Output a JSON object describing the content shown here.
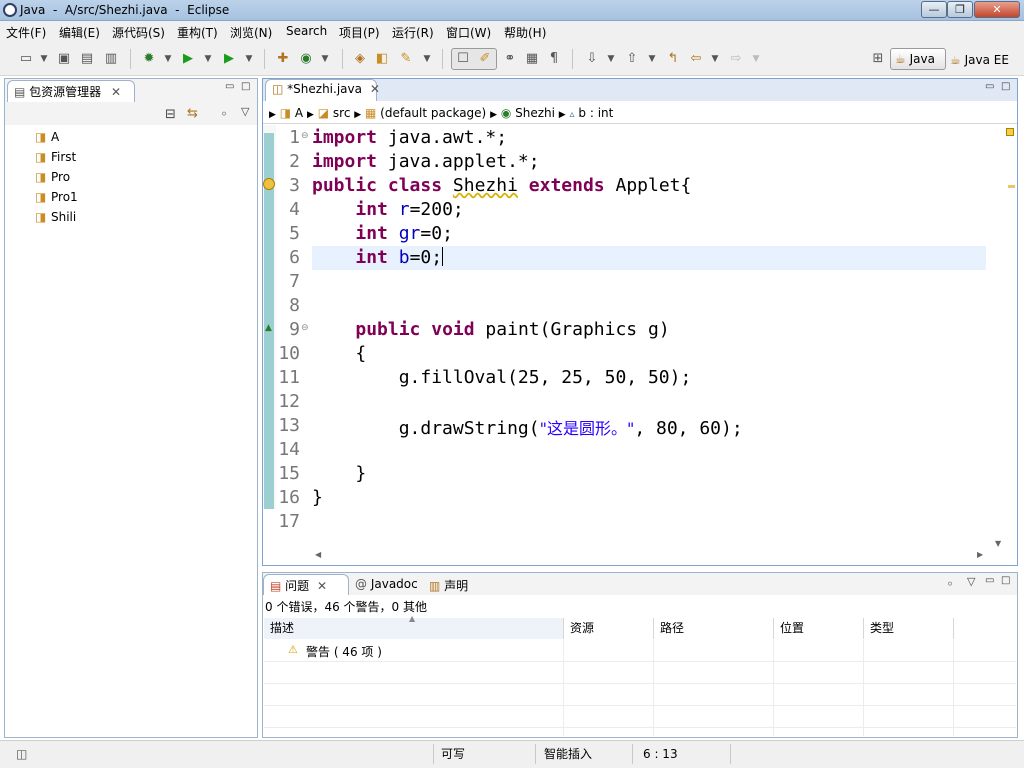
{
  "window": {
    "title": "Java  -  A/src/Shezhi.java  -  Eclipse",
    "min_glyph": "—",
    "max_glyph": "❐",
    "close_glyph": "✕"
  },
  "menus": [
    "文件(F)",
    "编辑(E)",
    "源代码(S)",
    "重构(T)",
    "浏览(N)",
    "Search",
    "项目(P)",
    "运行(R)",
    "窗口(W)",
    "帮助(H)"
  ],
  "perspectives": {
    "java": "Java",
    "java_ee": "Java EE"
  },
  "explorer": {
    "tab": "包资源管理器",
    "projects": [
      "A",
      "First",
      "Pro",
      "Pro1",
      "Shili"
    ]
  },
  "editor": {
    "tab": "*Shezhi.java",
    "breadcrumb": [
      "A",
      "src",
      "(default package)",
      "Shezhi",
      "b : int"
    ],
    "line_numbers": [
      "1",
      "2",
      "3",
      "4",
      "5",
      "6",
      "7",
      "8",
      "9",
      "10",
      "11",
      "12",
      "13",
      "14",
      "15",
      "16",
      "17"
    ],
    "code": {
      "l1_kw": "import",
      "l1_rest": " java.awt.*;",
      "l2_kw": "import",
      "l2_rest": " java.applet.*;",
      "l3_kw1": "public",
      "l3_kw2": "class",
      "l3_name": "Shezhi",
      "l3_kw3": "extends",
      "l3_rest": " Applet{",
      "l4_kw": "int",
      "l4_fld": "r",
      "l4_rest": "=200;",
      "l5_kw": "int",
      "l5_fld": "gr",
      "l5_rest": "=0;",
      "l6_kw": "int",
      "l6_fld": "b",
      "l6_rest": "=0;",
      "l9_kw1": "public",
      "l9_kw2": "void",
      "l9_rest": " paint(Graphics g)",
      "l10": "{",
      "l11": "g.fillOval(25, 25, 50, 50);",
      "l13_a": "g.drawString(",
      "l13_str": "\"这是圆形。\"",
      "l13_b": ", 80, 60);",
      "l15": "}",
      "l16": "}"
    }
  },
  "problems": {
    "tabs": [
      "问题",
      "Javadoc",
      "声明"
    ],
    "summary": "0 个错误，46 个警告，0 其他",
    "columns": [
      "描述",
      "资源",
      "路径",
      "位置",
      "类型"
    ],
    "warning_row": "警告 ( 46 项 )"
  },
  "status": {
    "mode": "可写",
    "insert": "智能插入",
    "position": "6 : 13"
  },
  "colors": {
    "keyword": "#7f0055",
    "field": "#0000c0",
    "string": "#2a00ff",
    "current_line": "#e8f2fe"
  }
}
